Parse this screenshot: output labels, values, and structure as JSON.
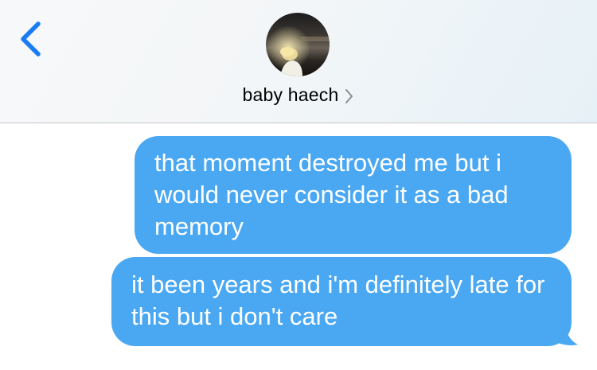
{
  "header": {
    "back_icon": "chevron-left-icon",
    "contact_name": "baby haech",
    "contact_chevron_icon": "chevron-right-icon",
    "accent_color": "#1a7cf5"
  },
  "messages": [
    {
      "direction": "outgoing",
      "text": "that moment destroyed me but i would never consider it as a bad memory"
    },
    {
      "direction": "outgoing",
      "text": "it been years and i'm definitely late for this but i don't care"
    }
  ],
  "colors": {
    "outgoing_bubble": "#4aa8f2",
    "bubble_text": "#ffffff"
  }
}
